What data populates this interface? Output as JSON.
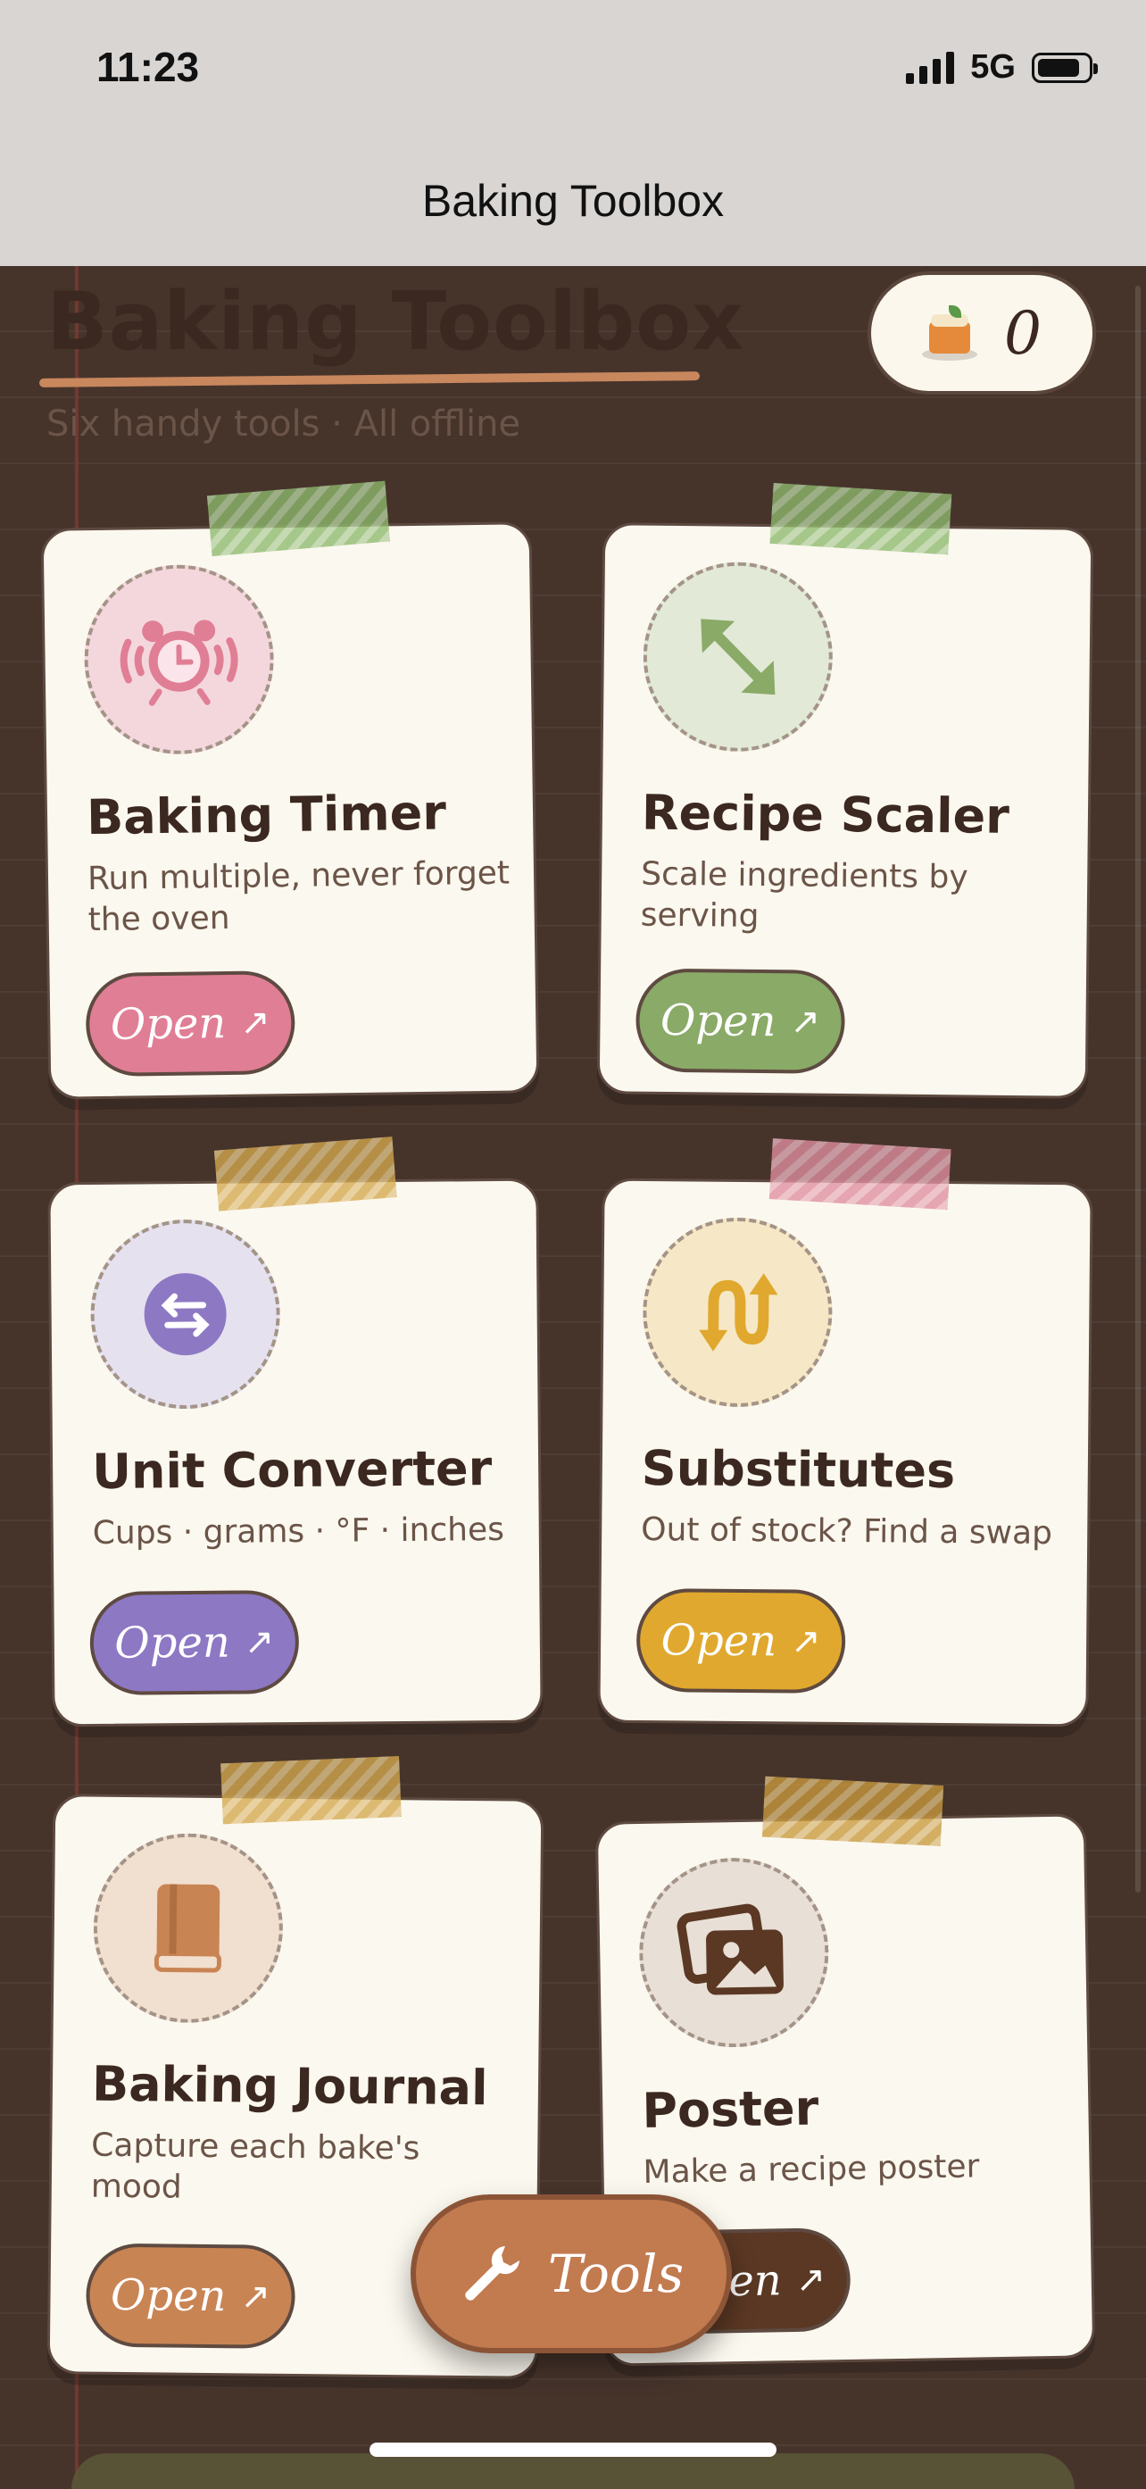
{
  "status": {
    "time": "11:23",
    "network": "5G"
  },
  "nav": {
    "title": "Baking Toolbox"
  },
  "hero": {
    "title": "Baking Toolbox",
    "subtitle": "Six handy tools · All offline"
  },
  "counter": {
    "icon": "cake-icon",
    "value": "0"
  },
  "cards": [
    {
      "title": "Baking Timer",
      "desc": "Run multiple, never forget the oven",
      "button": "Open",
      "accent": "#e07e95",
      "tape": "#8fba6e",
      "badge_bg": "#f4d7dc",
      "icon": "alarm-clock-icon"
    },
    {
      "title": "Recipe Scaler",
      "desc": "Scale ingredients by serving",
      "button": "Open",
      "accent": "#8aaa67",
      "tape": "#8fba6e",
      "badge_bg": "#e2e9d6",
      "icon": "resize-arrows-icon"
    },
    {
      "title": "Unit Converter",
      "desc": "Cups · grams · °F · inches",
      "button": "Open",
      "accent": "#8d78c4",
      "tape": "#d5a94e",
      "badge_bg": "#e6e1ee",
      "icon": "swap-arrows-icon"
    },
    {
      "title": "Substitutes",
      "desc": "Out of stock? Find a swap",
      "button": "Open",
      "accent": "#e0a82e",
      "tape": "#e08fa0",
      "badge_bg": "#f6e8c6",
      "icon": "swap-curve-icon"
    },
    {
      "title": "Baking Journal",
      "desc": "Capture each bake's mood",
      "button": "Open",
      "accent": "#c98454",
      "tape": "#d5a94e",
      "badge_bg": "#f1dfcf",
      "icon": "book-icon"
    },
    {
      "title": "Poster",
      "desc": "Make a recipe poster",
      "button": "Open",
      "accent": "#5b3824",
      "tape": "#c99a3c",
      "badge_bg": "#e8dfd6",
      "icon": "photos-icon"
    }
  ],
  "fab": {
    "label": "Tools",
    "icon": "wrench-icon"
  }
}
